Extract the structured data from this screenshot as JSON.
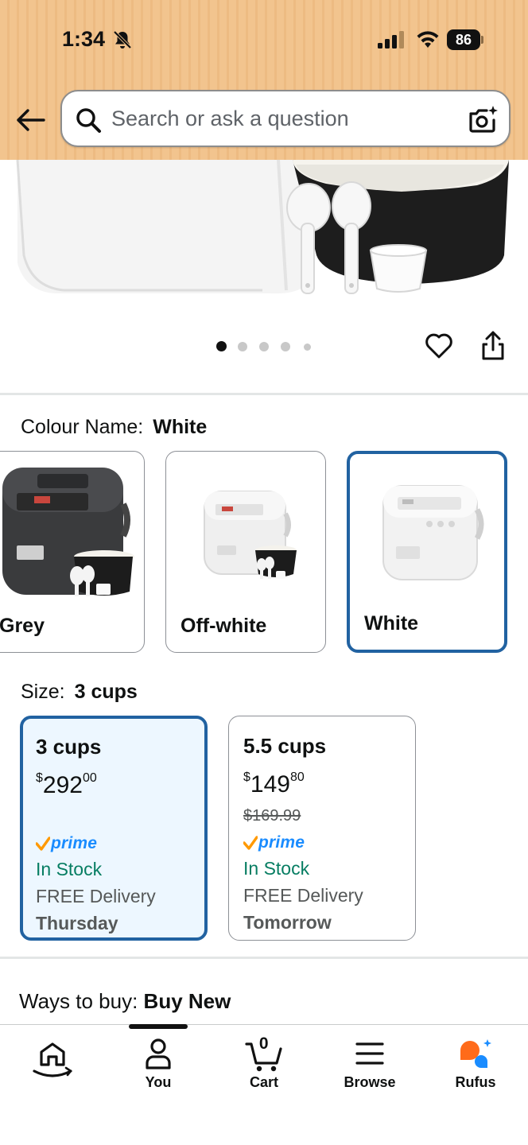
{
  "status_bar": {
    "time": "1:34",
    "battery": "86"
  },
  "search": {
    "placeholder": "Search or ask a question"
  },
  "gallery": {
    "image_count": 5,
    "active_index": 0
  },
  "colour": {
    "label": "Colour Name:",
    "selected": "White",
    "options": [
      {
        "name": "Grey"
      },
      {
        "name": "Off-white"
      },
      {
        "name": "White"
      }
    ]
  },
  "size": {
    "label": "Size:",
    "selected": "3 cups",
    "options": [
      {
        "title": "3 cups",
        "currency": "$",
        "price_whole": "292",
        "price_fraction": "00",
        "list_price": "",
        "prime": "prime",
        "stock": "In Stock",
        "delivery": "FREE Delivery",
        "delivery_day": "Thursday"
      },
      {
        "title": "5.5 cups",
        "currency": "$",
        "price_whole": "149",
        "price_fraction": "80",
        "list_price": "$169.99",
        "prime": "prime",
        "stock": "In Stock",
        "delivery": "FREE Delivery",
        "delivery_day": "Tomorrow"
      }
    ]
  },
  "ways_to_buy": {
    "label": "Ways to buy:",
    "value": "Buy New"
  },
  "bottom_nav": {
    "items": [
      {
        "label": "",
        "icon": "home-icon"
      },
      {
        "label": "You",
        "icon": "person-icon"
      },
      {
        "label": "Cart",
        "icon": "cart-icon",
        "count": "0"
      },
      {
        "label": "Browse",
        "icon": "menu-icon"
      },
      {
        "label": "Rufus",
        "icon": "rufus-icon"
      }
    ]
  },
  "colors": {
    "header": "#f2c48e",
    "selected_border": "#2162a1",
    "selected_bg": "#edf7ff",
    "in_stock": "#067d62",
    "prime_blue": "#1a8cff",
    "prime_check": "#ff9900",
    "rufus_orange": "#ff6b1a",
    "rufus_blue": "#1a8cff"
  }
}
